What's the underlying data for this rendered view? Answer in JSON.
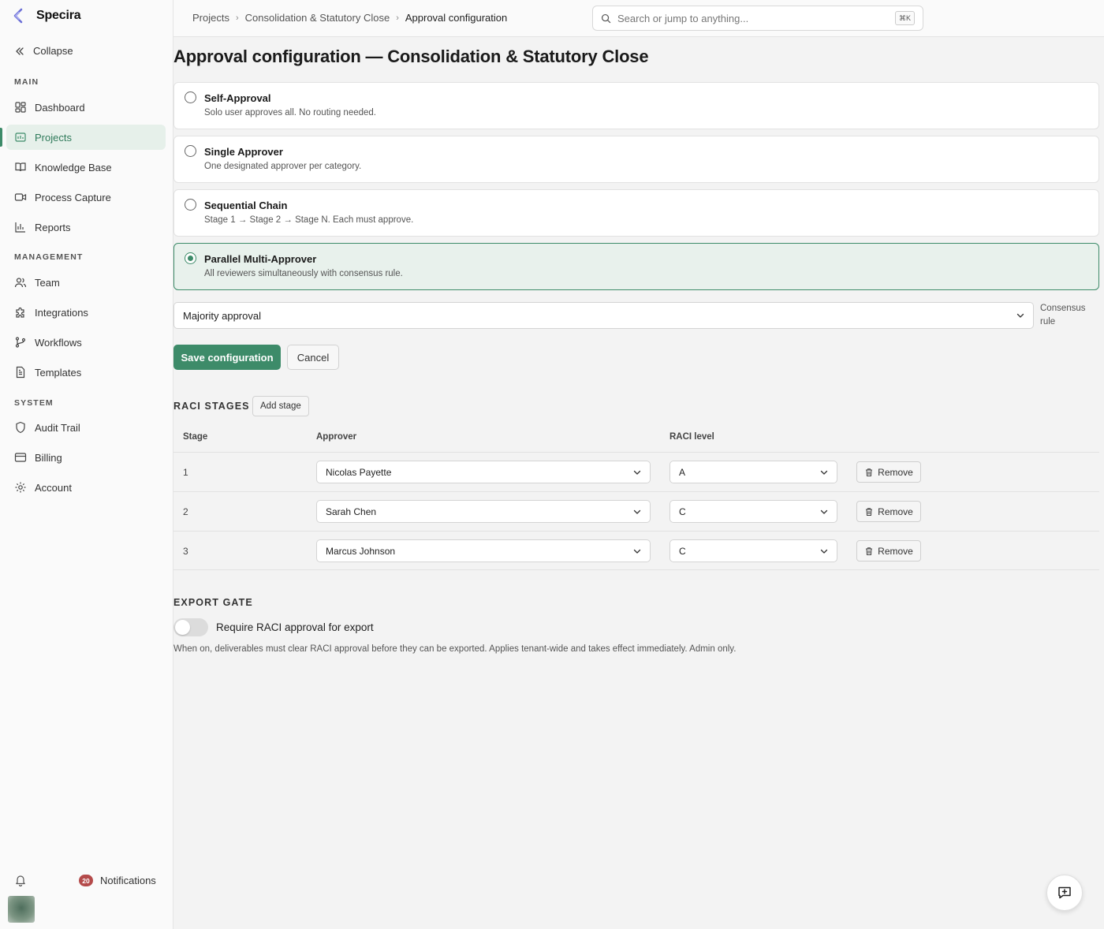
{
  "app": {
    "name": "Specira"
  },
  "sidebar": {
    "collapse_label": "Collapse",
    "sections": {
      "main": "MAIN",
      "management": "MANAGEMENT",
      "system": "SYSTEM"
    },
    "items": [
      {
        "label": "Dashboard",
        "icon": "dashboard-icon"
      },
      {
        "label": "Projects",
        "icon": "projects-icon",
        "active": true
      },
      {
        "label": "Knowledge Base",
        "icon": "book-icon"
      },
      {
        "label": "Process Capture",
        "icon": "video-icon"
      },
      {
        "label": "Reports",
        "icon": "bar-chart-icon"
      },
      {
        "label": "Team",
        "icon": "users-icon"
      },
      {
        "label": "Integrations",
        "icon": "puzzle-icon"
      },
      {
        "label": "Workflows",
        "icon": "git-branch-icon"
      },
      {
        "label": "Templates",
        "icon": "document-icon"
      },
      {
        "label": "Audit Trail",
        "icon": "shield-icon"
      },
      {
        "label": "Billing",
        "icon": "credit-card-icon"
      },
      {
        "label": "Account",
        "icon": "gear-icon"
      }
    ],
    "notifications": {
      "count": "20",
      "label": "Notifications"
    }
  },
  "topbar": {
    "breadcrumb": [
      "Projects",
      "Consolidation & Statutory Close",
      "Approval configuration"
    ],
    "search_placeholder": "Search or jump to anything...",
    "search_shortcut": "⌘K"
  },
  "page": {
    "title": "Approval configuration — Consolidation & Statutory Close",
    "options": [
      {
        "title": "Self-Approval",
        "description": "Solo user approves all. No routing needed.",
        "selected": false
      },
      {
        "title": "Single Approver",
        "description": "One designated approver per category.",
        "selected": false
      },
      {
        "title": "Sequential Chain",
        "description": "Stage 1 → Stage 2 → Stage N. Each must approve.",
        "selected": false
      },
      {
        "title": "Parallel Multi-Approver",
        "description": "All reviewers simultaneously with consensus rule.",
        "selected": true
      }
    ],
    "consensus": {
      "value": "Majority approval",
      "label": "Consensus rule"
    },
    "save_label": "Save configuration",
    "cancel_label": "Cancel",
    "raci": {
      "heading": "RACI STAGES",
      "add_label": "Add stage",
      "columns": [
        "Stage",
        "Approver",
        "RACI level"
      ],
      "rows": [
        {
          "stage": "1",
          "approver": "Nicolas Payette",
          "level": "A",
          "remove": "Remove"
        },
        {
          "stage": "2",
          "approver": "Sarah Chen",
          "level": "C",
          "remove": "Remove"
        },
        {
          "stage": "3",
          "approver": "Marcus Johnson",
          "level": "C",
          "remove": "Remove"
        }
      ]
    },
    "export_gate": {
      "heading": "EXPORT GATE",
      "toggle_label": "Require RACI approval for export",
      "toggle_on": false,
      "help": "When on, deliverables must clear RACI approval before they can be exported. Applies tenant-wide and takes effect immediately. Admin only."
    }
  },
  "colors": {
    "accent": "#3d8b69",
    "selected_bg": "#e8f1ec",
    "badge": "#b44a4a"
  }
}
